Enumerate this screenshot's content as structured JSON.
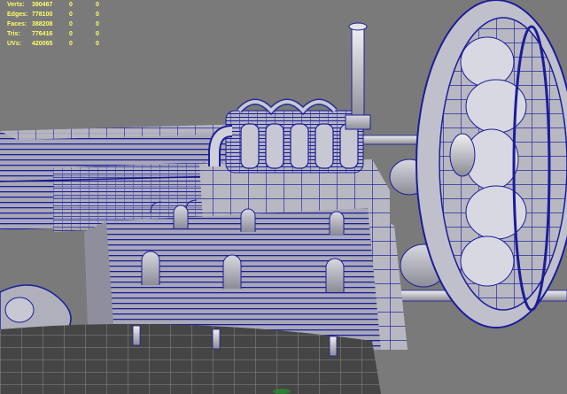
{
  "viewport": {
    "background_color": "#7a7a7a",
    "wire_color": "#1c1c9a",
    "hud_color": "#ffff66"
  },
  "hud": {
    "rows": [
      {
        "label": "Verts:",
        "v1": "390467",
        "v2": "0",
        "v3": "0"
      },
      {
        "label": "Edges:",
        "v1": "778100",
        "v2": "0",
        "v3": "0"
      },
      {
        "label": "Faces:",
        "v1": "388208",
        "v2": "0",
        "v3": "0"
      },
      {
        "label": "Tris:",
        "v1": "776416",
        "v2": "0",
        "v3": "0"
      },
      {
        "label": "UVs:",
        "v1": "420065",
        "v2": "0",
        "v3": "0"
      }
    ]
  },
  "scene": {
    "parts": [
      {
        "name": "engine-block-mesh"
      },
      {
        "name": "exhaust-manifold-mesh"
      },
      {
        "name": "exhaust-stack-mesh"
      },
      {
        "name": "radial-fan-wheel-mesh"
      },
      {
        "name": "drive-shaft-mesh"
      },
      {
        "name": "long-housing-mesh"
      },
      {
        "name": "front-ornament-mesh"
      }
    ]
  }
}
